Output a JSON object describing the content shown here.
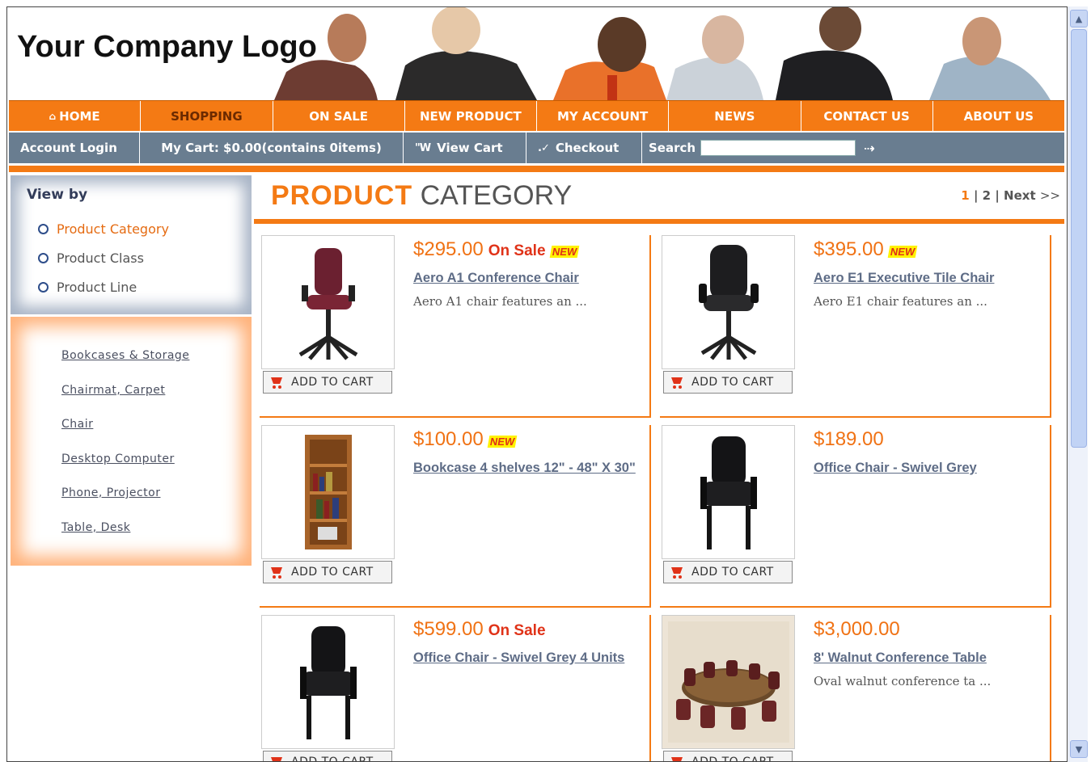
{
  "header": {
    "logo_text": "Your Company Logo"
  },
  "nav": {
    "items": [
      {
        "label": "HOME"
      },
      {
        "label": "SHOPPING"
      },
      {
        "label": "ON SALE"
      },
      {
        "label": "NEW PRODUCT"
      },
      {
        "label": "MY ACCOUNT"
      },
      {
        "label": "NEWS"
      },
      {
        "label": "CONTACT US"
      },
      {
        "label": "ABOUT US"
      }
    ],
    "active_index": 1
  },
  "subbar": {
    "account_login": "Account Login",
    "cart_summary": "My Cart: $0.00(contains 0items)",
    "view_cart": "View Cart",
    "checkout": "Checkout",
    "search_label": "Search",
    "search_value": ""
  },
  "sidebar": {
    "viewby_title": "View by",
    "viewby_options": [
      "Product Category",
      "Product Class",
      "Product Line"
    ],
    "viewby_selected": 0,
    "categories": [
      "Bookcases & Storage",
      "Chairmat, Carpet",
      "Chair",
      "Desktop Computer",
      "Phone, Projector",
      "Table, Desk"
    ]
  },
  "content": {
    "title_bold": "PRODUCT",
    "title_light": "CATEGORY",
    "pager": {
      "current": "1",
      "sep1": "|",
      "page2": "2",
      "sep2": "|",
      "next": "Next",
      "arrows": ">>"
    }
  },
  "products": [
    {
      "price": "$295.00",
      "on_sale": "On Sale",
      "new": "NEW",
      "name": "Aero A1 Conference Chair",
      "desc": "Aero A1 chair features an ...",
      "cart": "ADD TO CART"
    },
    {
      "price": "$395.00",
      "on_sale": "",
      "new": "NEW",
      "name": "Aero E1 Executive Tile Chair",
      "desc": "Aero E1 chair features an ...",
      "cart": "ADD TO CART"
    },
    {
      "price": "$100.00",
      "on_sale": "",
      "new": "NEW",
      "name": "Bookcase 4 shelves 12\" - 48\" X 30\"",
      "desc": "",
      "cart": "ADD TO CART"
    },
    {
      "price": "$189.00",
      "on_sale": "",
      "new": "",
      "name": "Office Chair - Swivel Grey",
      "desc": "",
      "cart": "ADD TO CART"
    },
    {
      "price": "$599.00",
      "on_sale": "On Sale",
      "new": "",
      "name": "Office Chair - Swivel Grey 4 Units",
      "desc": "",
      "cart": "ADD TO CART"
    },
    {
      "price": "$3,000.00",
      "on_sale": "",
      "new": "",
      "name": "8' Walnut Conference Table",
      "desc": "Oval walnut conference ta ...",
      "cart": "ADD TO CART"
    }
  ],
  "colors": {
    "accent": "#f47a14",
    "subbar": "#697d90",
    "price": "#f07214",
    "sale": "#e03218"
  }
}
